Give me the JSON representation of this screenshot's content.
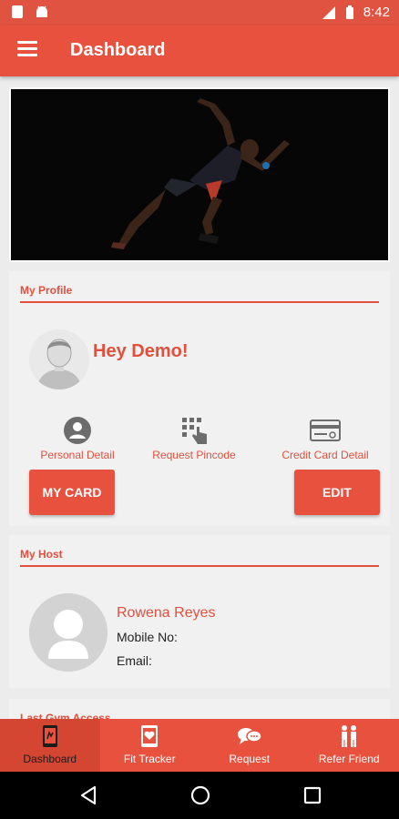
{
  "status_bar": {
    "time": "8:42",
    "network": "LTE"
  },
  "app_bar": {
    "title": "Dashboard"
  },
  "profile": {
    "section_title": "My Profile",
    "greeting": "Hey Demo!",
    "actions": [
      {
        "label": "Personal Detail",
        "icon": "person-icon"
      },
      {
        "label": "Request Pincode",
        "icon": "keypad-touch-icon"
      },
      {
        "label": "Credit Card Detail",
        "icon": "credit-card-icon"
      }
    ],
    "my_card_label": "MY CARD",
    "edit_label": "EDIT"
  },
  "host": {
    "section_title": "My Host",
    "name": "Rowena Reyes",
    "mobile_label": "Mobile No:",
    "email_label": "Email:"
  },
  "last_access": {
    "section_title": "Last Gym Access"
  },
  "bottom_nav": {
    "items": [
      {
        "label": "Dashboard",
        "icon": "phone-gym-icon",
        "active": true
      },
      {
        "label": "Fit Tracker",
        "icon": "heart-phone-icon",
        "active": false
      },
      {
        "label": "Request",
        "icon": "chat-bubbles-icon",
        "active": false
      },
      {
        "label": "Refer Friend",
        "icon": "people-icon",
        "active": false
      }
    ]
  },
  "colors": {
    "accent": "#e8513e",
    "accent_dark": "#d44532",
    "card": "#f1f1f1",
    "background": "#ececec"
  }
}
